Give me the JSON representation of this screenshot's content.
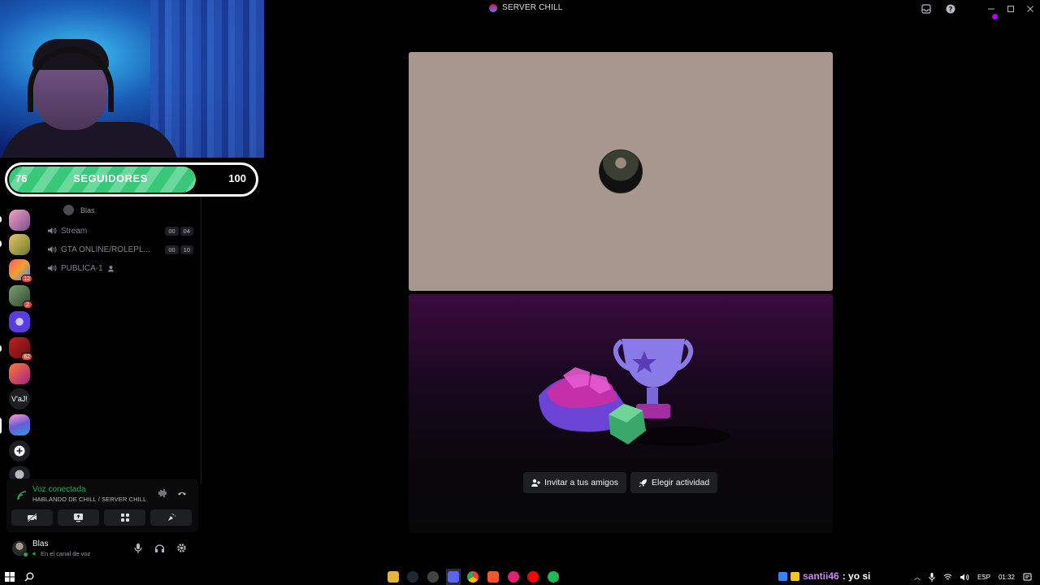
{
  "window": {
    "title": "SERVER CHILL"
  },
  "follower_goal": {
    "current": "76",
    "label": "SEGUIDORES",
    "target": "100",
    "fill_fraction": 0.76
  },
  "servers": [
    {
      "name": "server-1",
      "badge": ""
    },
    {
      "name": "server-2",
      "badge": ""
    },
    {
      "name": "server-3",
      "badge": "12"
    },
    {
      "name": "server-4",
      "badge": "2"
    },
    {
      "name": "server-5",
      "badge": ""
    },
    {
      "name": "server-6",
      "badge": "62"
    },
    {
      "name": "server-7",
      "badge": ""
    },
    {
      "name": "server-8",
      "text": "V'aJ!"
    },
    {
      "name": "server-9",
      "badge": ""
    }
  ],
  "channels": {
    "voice_user": "Blas",
    "items": [
      {
        "name": "Stream",
        "count_a": "00",
        "count_b": "04"
      },
      {
        "name": "GTA ONLINE/ROLEPL...",
        "count_a": "00",
        "count_b": "10"
      },
      {
        "name": "PUBLICA-1",
        "count_a": "",
        "count_b": ""
      }
    ]
  },
  "voice_panel": {
    "status": "Voz conectada",
    "channel": "HABLANDO DE CHILL / SERVER CHILL"
  },
  "user": {
    "name": "Blas",
    "status": "En el canal de voz"
  },
  "activity": {
    "invite_label": "Invitar a tus amigos",
    "choose_label": "Elegir actividad"
  },
  "taskbar": {
    "chat_user": "santii46",
    "chat_message": ": yo si",
    "language": "ESP",
    "time": "01:32"
  },
  "colors": {
    "stage_bg": "#a8978e",
    "voice_green": "#23a55a",
    "badge_red": "#f23f43",
    "progress_green": "#39c77a",
    "cursor_purple": "#b400ff"
  }
}
